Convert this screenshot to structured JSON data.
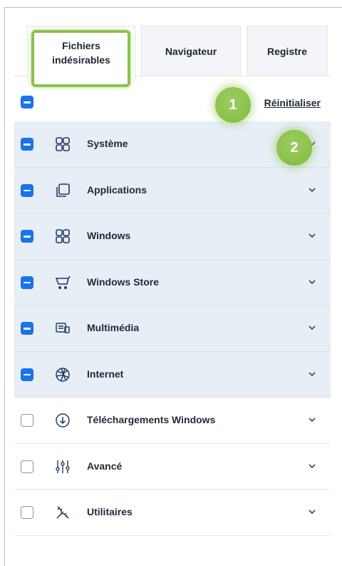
{
  "tabs": [
    {
      "label_line1": "Fichiers",
      "label_line2": "indésirables",
      "active": true
    },
    {
      "label": "Navigateur"
    },
    {
      "label": "Registre"
    }
  ],
  "header": {
    "reset_label": "Réinitialiser",
    "select_all_checked": true
  },
  "categories": [
    {
      "label": "Système",
      "icon": "grid-icon",
      "checked": true
    },
    {
      "label": "Applications",
      "icon": "stacked-windows-icon",
      "checked": true
    },
    {
      "label": "Windows",
      "icon": "grid-icon",
      "checked": true
    },
    {
      "label": "Windows Store",
      "icon": "cart-icon",
      "checked": true
    },
    {
      "label": "Multimédia",
      "icon": "media-icon",
      "checked": true
    },
    {
      "label": "Internet",
      "icon": "globe-icon",
      "checked": true
    },
    {
      "label": "Téléchargements Windows",
      "icon": "download-icon",
      "checked": false
    },
    {
      "label": "Avancé",
      "icon": "sliders-icon",
      "checked": false
    },
    {
      "label": "Utilitaires",
      "icon": "tools-icon",
      "checked": false
    }
  ],
  "annotations": [
    {
      "number": "1"
    },
    {
      "number": "2"
    }
  ],
  "colors": {
    "accent": "#1a73e8",
    "highlight": "#8bc34a",
    "selected_row": "#e8eef6"
  }
}
